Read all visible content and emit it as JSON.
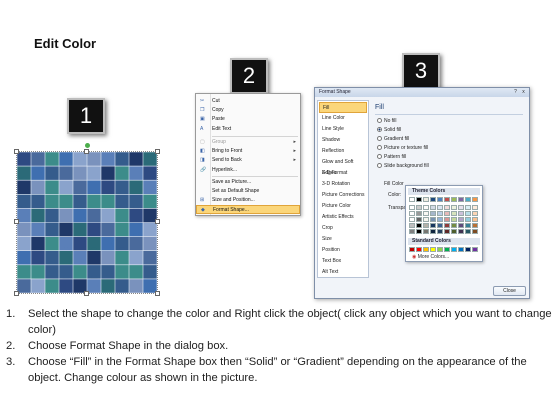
{
  "slide": {
    "title": "Edit Color"
  },
  "steps": [
    "1",
    "2",
    "3"
  ],
  "context_menu": {
    "items": [
      {
        "label": "Cut",
        "icon": "scissors-icon",
        "disabled": false,
        "submenu": false,
        "highlighted": false
      },
      {
        "label": "Copy",
        "icon": "copy-icon",
        "disabled": false,
        "submenu": false,
        "highlighted": false
      },
      {
        "label": "Paste",
        "icon": "paste-icon",
        "disabled": false,
        "submenu": false,
        "highlighted": false
      },
      {
        "label": "Edit Text",
        "icon": "edit-text-icon",
        "disabled": false,
        "submenu": false,
        "highlighted": false
      },
      {
        "label": "Group",
        "icon": "group-icon",
        "disabled": true,
        "submenu": true,
        "highlighted": false
      },
      {
        "label": "Bring to Front",
        "icon": "bring-front-icon",
        "disabled": false,
        "submenu": true,
        "highlighted": false
      },
      {
        "label": "Send to Back",
        "icon": "send-back-icon",
        "disabled": false,
        "submenu": true,
        "highlighted": false
      },
      {
        "label": "Hyperlink...",
        "icon": "hyperlink-icon",
        "disabled": false,
        "submenu": false,
        "highlighted": false
      },
      {
        "label": "Save as Picture...",
        "icon": "",
        "disabled": false,
        "submenu": false,
        "highlighted": false
      },
      {
        "label": "Set as Default Shape",
        "icon": "",
        "disabled": false,
        "submenu": false,
        "highlighted": false
      },
      {
        "label": "Size and Position...",
        "icon": "size-position-icon",
        "disabled": false,
        "submenu": false,
        "highlighted": false
      },
      {
        "label": "Format Shape...",
        "icon": "format-shape-icon",
        "disabled": false,
        "submenu": false,
        "highlighted": true
      }
    ]
  },
  "dialog": {
    "title": "Format Shape",
    "help": "?",
    "close_glyph": "x",
    "nav": [
      "Fill",
      "Line Color",
      "Line Style",
      "Shadow",
      "Reflection",
      "Glow and Soft Edges",
      "3-D Format",
      "3-D Rotation",
      "Picture Corrections",
      "Picture Color",
      "Artistic Effects",
      "Crop",
      "Size",
      "Position",
      "Text Box",
      "Alt Text"
    ],
    "selected_nav": "Fill",
    "fill_heading": "Fill",
    "fill_options": [
      {
        "label": "No fill",
        "checked": false
      },
      {
        "label": "Solid fill",
        "checked": true
      },
      {
        "label": "Gradient fill",
        "checked": false
      },
      {
        "label": "Picture or texture fill",
        "checked": false
      },
      {
        "label": "Pattern fill",
        "checked": false
      },
      {
        "label": "Slide background fill",
        "checked": false
      }
    ],
    "fill_color_label": "Fill Color",
    "color_label": "Color:",
    "transparency_label": "Transpa",
    "close_label": "Close"
  },
  "palette": {
    "theme_title": "Theme Colors",
    "standard_title": "Standard Colors",
    "more_colors": "More Colors...",
    "theme_top": [
      "#ffffff",
      "#000000",
      "#eeece1",
      "#1f497d",
      "#4f81bd",
      "#c0504d",
      "#9bbb59",
      "#8064a2",
      "#4bacc6",
      "#f79646"
    ],
    "standard": [
      "#c00000",
      "#ff0000",
      "#ffc000",
      "#ffff00",
      "#92d050",
      "#00b050",
      "#00b0f0",
      "#0070c0",
      "#002060",
      "#7030a0"
    ]
  },
  "puzzle": {
    "colors": [
      "#2e4a82",
      "#3f6fb0",
      "#5a7fb8",
      "#2b6a78",
      "#3c8c8a",
      "#7a92bd",
      "#1f3868",
      "#4a6a9c",
      "#8aa3cc",
      "#355c8c"
    ]
  },
  "instructions": [
    {
      "num": "1.",
      "text": "Select the shape to change the color and Right click the object( click any object which you want to change color)"
    },
    {
      "num": "2.",
      "text": "Choose Format Shape in the dialog box."
    },
    {
      "num": "3.",
      "text": "Choose “Fill” in the Format Shape box then “Solid” or “Gradient” depending on the appearance of the object. Change colour as shown in the picture."
    }
  ]
}
